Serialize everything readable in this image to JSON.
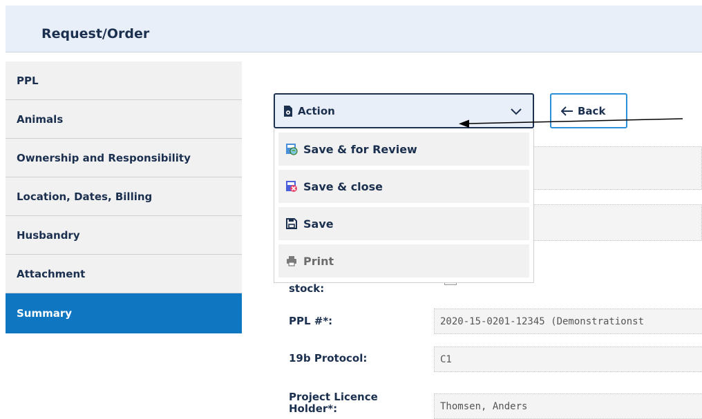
{
  "header": {
    "title": "Request/Order"
  },
  "sidebar": {
    "items": [
      {
        "label": "PPL"
      },
      {
        "label": "Animals"
      },
      {
        "label": "Ownership and Responsibility"
      },
      {
        "label": "Location, Dates, Billing"
      },
      {
        "label": "Husbandry"
      },
      {
        "label": "Attachment"
      },
      {
        "label": "Summary",
        "active": true
      }
    ]
  },
  "toolbar": {
    "action_label": "Action",
    "back_label": "Back"
  },
  "action_menu": {
    "items": [
      {
        "label": "Save & for Review",
        "icon": "review-icon"
      },
      {
        "label": "Save & close",
        "icon": "close-save-icon"
      },
      {
        "label": "Save",
        "icon": "floppy-icon"
      },
      {
        "label": "Print",
        "icon": "printer-icon"
      }
    ]
  },
  "form": {
    "stock_label_partial": "stock:",
    "ppl_label": "PPL #*:",
    "ppl_value": "2020-15-0201-12345 (Demonstrationst",
    "protocol_label": "19b Protocol:",
    "protocol_value": "C1",
    "holder_label_line1": "Project Licence",
    "holder_label_line2": "Holder*:",
    "holder_value": "Thomsen, Anders"
  },
  "colors": {
    "accent": "#0f76c2",
    "navy": "#1b2f4e",
    "header_bg": "#e9eff8"
  }
}
